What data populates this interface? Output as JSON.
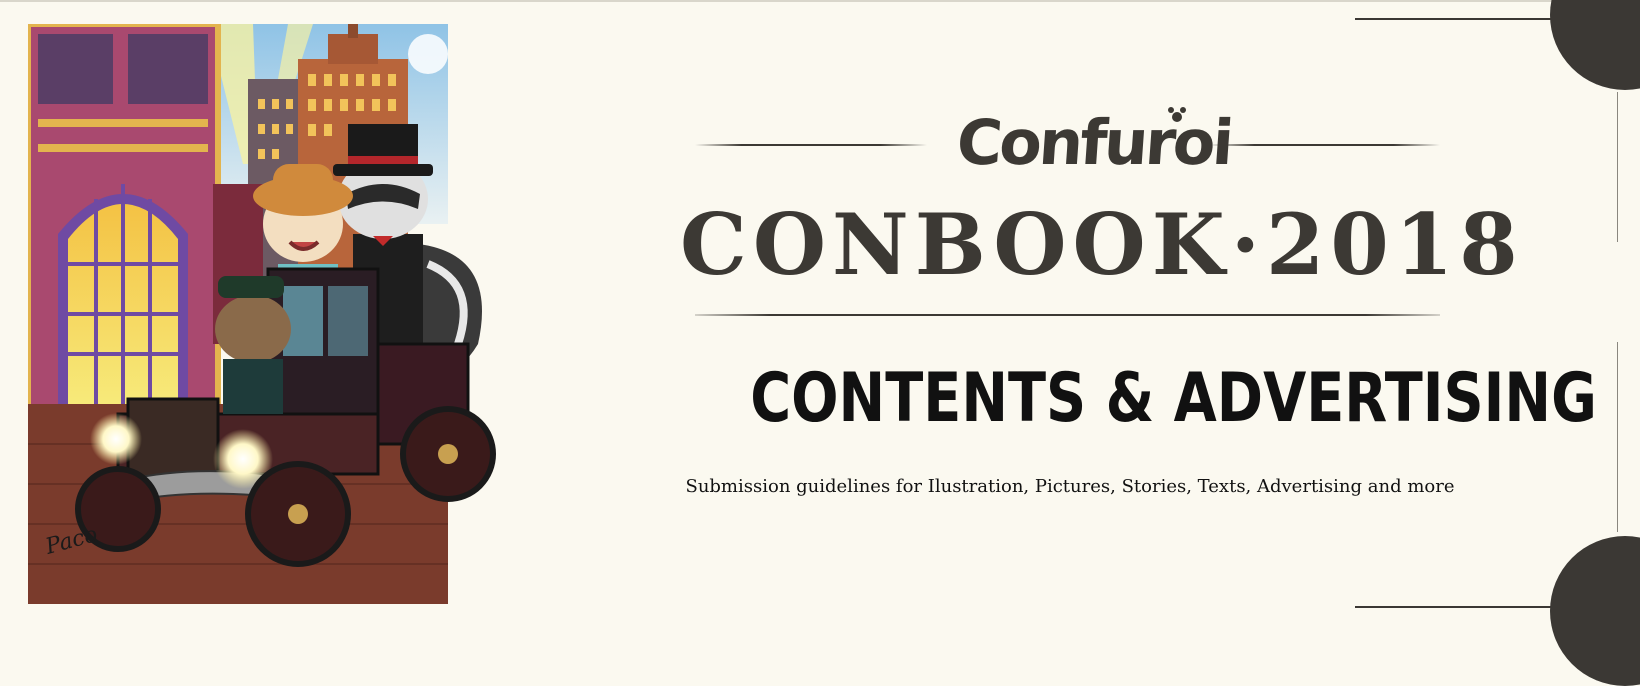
{
  "logo": {
    "text": "Confuroi"
  },
  "title": {
    "text": "CONBOOK·2018"
  },
  "section": {
    "title": "CONTENTS & ADVERTISING"
  },
  "subtitle": {
    "text": "Submission guidelines for Ilustration, Pictures, Stories, Texts, Advertising and more"
  },
  "illustration": {
    "signature": "Paco"
  },
  "colors": {
    "ink": "#3c3934",
    "paper": "#fbf9f0",
    "accent_dark": "#3b3834"
  }
}
